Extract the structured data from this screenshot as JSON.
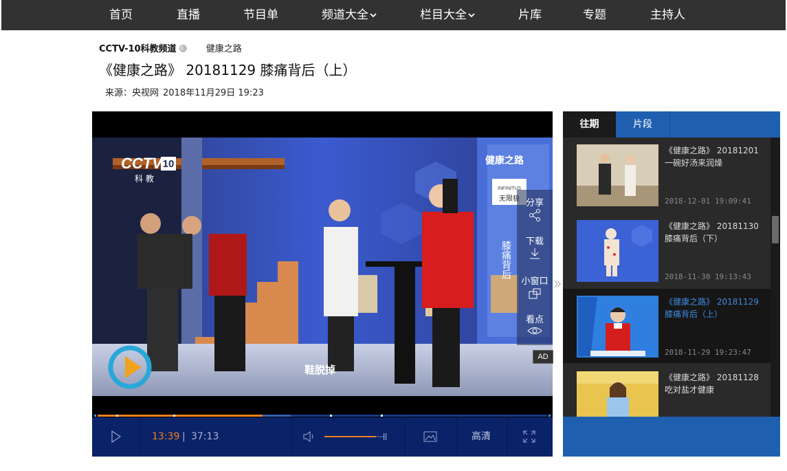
{
  "nav": {
    "items": [
      {
        "label": "首页",
        "dropdown": false
      },
      {
        "label": "直播",
        "dropdown": false
      },
      {
        "label": "节目单",
        "dropdown": false
      },
      {
        "label": "频道大全",
        "dropdown": true
      },
      {
        "label": "栏目大全",
        "dropdown": true
      },
      {
        "label": "片库",
        "dropdown": false
      },
      {
        "label": "专题",
        "dropdown": false
      },
      {
        "label": "主持人",
        "dropdown": false
      }
    ]
  },
  "breadcrumb": {
    "channel": "CCTV-10科教频道",
    "column": "健康之路"
  },
  "page_title": "《健康之路》 20181129 膝痛背后（上）",
  "meta": {
    "source": "来源：央视网",
    "datetime": "2018年11月29日 19:23"
  },
  "video": {
    "logo_main": "CCTV",
    "logo_num": "10",
    "logo_sub": "科 教",
    "show_logo": "健康之路",
    "caption": "鞋脱掉",
    "sponsor": "INFINITUS",
    "sponsor_cn": "无限极",
    "ad_label": "AD",
    "side_text": "膝痛背后"
  },
  "side_tools": [
    {
      "label": "分享",
      "icon": "share-icon"
    },
    {
      "label": "下载",
      "icon": "download-icon"
    },
    {
      "label": "小窗口",
      "icon": "mini-window-icon"
    },
    {
      "label": "看点",
      "icon": "eye-icon"
    }
  ],
  "player": {
    "current_time": "13:39",
    "time_separator": "|",
    "duration": "37:13",
    "played_fraction": 0.367,
    "buffered_fraction": 0.43,
    "volume_fraction": 0.85,
    "quality": "高清",
    "colors": {
      "played": "#f0821e",
      "control_bg": "#0a2268",
      "accent": "#1f5fb0"
    }
  },
  "panel": {
    "tabs": [
      {
        "label": "往期",
        "active": true
      },
      {
        "label": "片段",
        "active": false
      }
    ],
    "episodes": [
      {
        "title1": "《健康之路》 20181201",
        "title2": "一碗好汤来润燥",
        "date": "2018-12-01 19:09:41",
        "active": false
      },
      {
        "title1": "《健康之路》 20181130",
        "title2": "膝痛背后（下）",
        "date": "2018-11-30 19:13:43",
        "active": false
      },
      {
        "title1": "《健康之路》 20181129",
        "title2": "膝痛背后（上）",
        "date": "2018-11-29 19:23:47",
        "active": true
      },
      {
        "title1": "《健康之路》 20181128",
        "title2": "吃对盐才健康",
        "date": "",
        "active": false
      }
    ]
  }
}
